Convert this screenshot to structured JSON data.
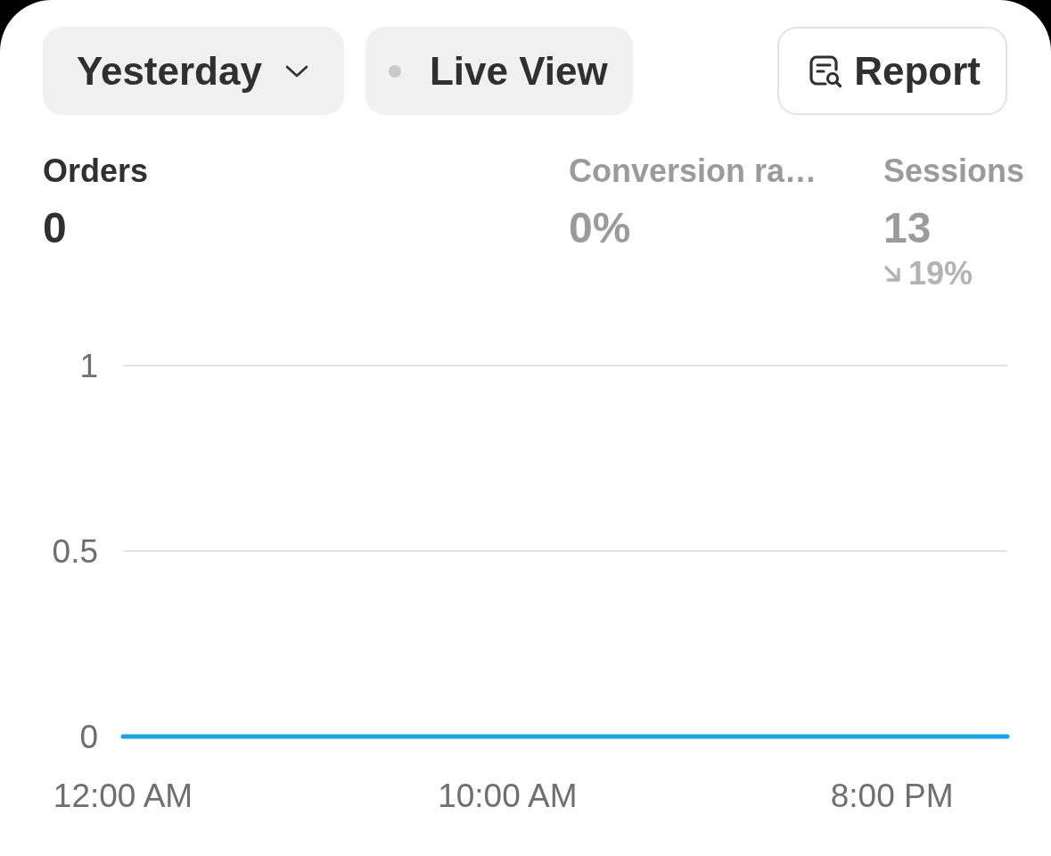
{
  "toolbar": {
    "date_range": {
      "label": "Yesterday"
    },
    "live_view": {
      "label": "Live View",
      "live": false
    },
    "report": {
      "label": "Report"
    }
  },
  "metrics": [
    {
      "label": "Orders",
      "value": "0",
      "selected": true
    },
    {
      "label": "Conversion ra…",
      "value": "0%",
      "selected": false
    },
    {
      "label": "Sessions",
      "value": "13",
      "selected": false,
      "change": {
        "negative": true,
        "text": "19%"
      }
    }
  ],
  "chart": {
    "chart_data": {
      "type": "line",
      "categories": [
        "12:00 AM",
        null,
        null,
        null,
        null,
        null,
        null,
        null,
        null,
        null,
        "10:00 AM",
        null,
        null,
        null,
        null,
        null,
        null,
        null,
        null,
        null,
        "8:00 PM",
        null,
        null,
        null
      ],
      "series": [
        {
          "color": "#14a4ec",
          "values": [
            0,
            0,
            0,
            0,
            0,
            0,
            0,
            0,
            0,
            0,
            0,
            0,
            0,
            0,
            0,
            0,
            0,
            0,
            0,
            0,
            0,
            0,
            0,
            0
          ]
        }
      ],
      "ylim": [
        0,
        1
      ],
      "yticks": [
        0,
        0.5,
        1
      ]
    }
  }
}
